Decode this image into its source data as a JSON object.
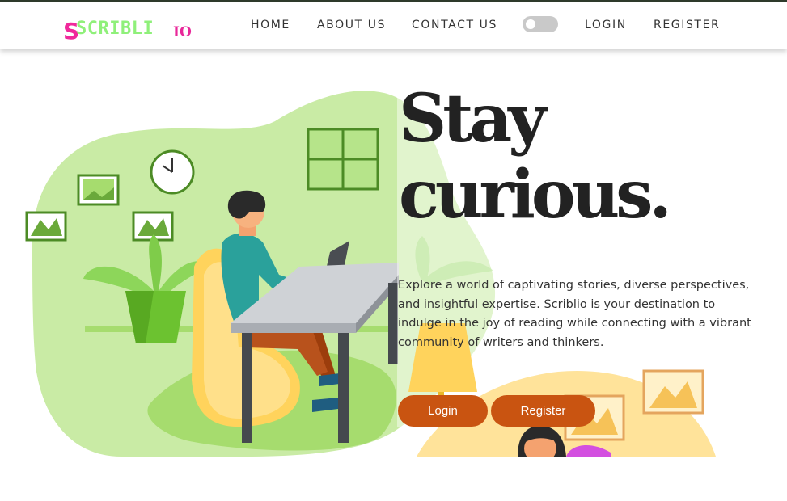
{
  "logo": {
    "first_letter": "S",
    "word": "SCRIBLI",
    "suffix": "IO"
  },
  "nav": {
    "home": "HOME",
    "about": "ABOUT US",
    "contact": "CONTACT US",
    "login": "LOGIN",
    "register": "REGISTER",
    "theme_toggle_on": false
  },
  "hero": {
    "headline_line1": "Stay",
    "headline_line2": "curious.",
    "description": "Explore a world of captivating stories, diverse perspectives, and insightful expertise. Scriblio is your destination to indulge in the joy of reading while connecting with a vibrant community of writers and thinkers.",
    "login_button": "Login",
    "register_button": "Register"
  },
  "colors": {
    "accent_button": "#c95411",
    "logo_pink": "#f0299b",
    "logo_green": "#8ff07a",
    "illustration_green": "#c9eba5",
    "illustration_yellow": "#ffd966"
  }
}
